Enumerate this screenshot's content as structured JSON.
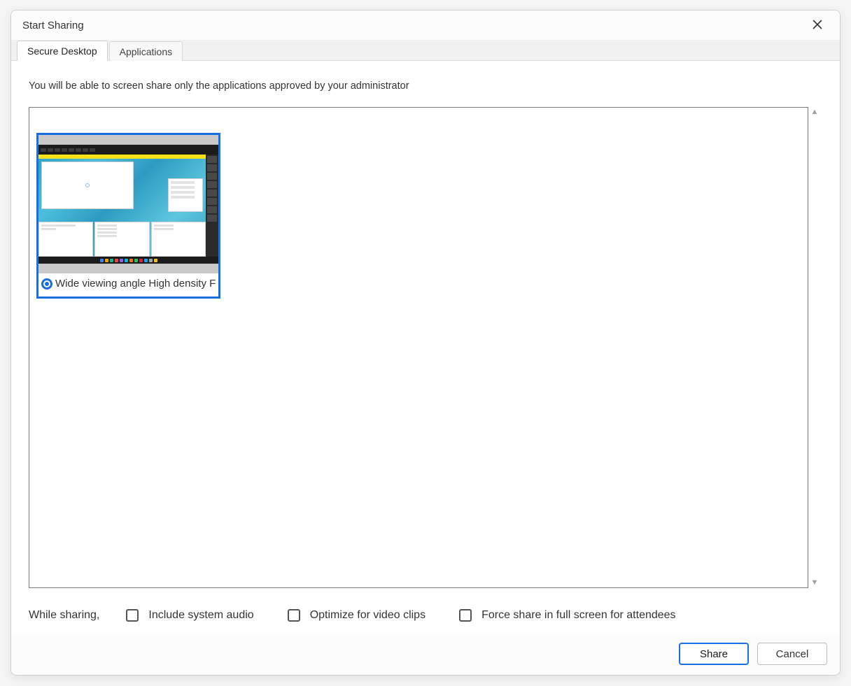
{
  "dialog": {
    "title": "Start Sharing"
  },
  "tabs": {
    "secure_desktop": "Secure Desktop",
    "applications": "Applications"
  },
  "content": {
    "info": "You will be able to screen share only the applications approved by your administrator",
    "screens": [
      {
        "label": "Wide viewing angle  High density F",
        "selected": true
      }
    ]
  },
  "footer": {
    "lead": "While sharing,",
    "options": {
      "include_audio": "Include system audio",
      "optimize_video": "Optimize for video clips",
      "force_fullscreen": "Force share in full screen for attendees"
    }
  },
  "buttons": {
    "share": "Share",
    "cancel": "Cancel"
  }
}
